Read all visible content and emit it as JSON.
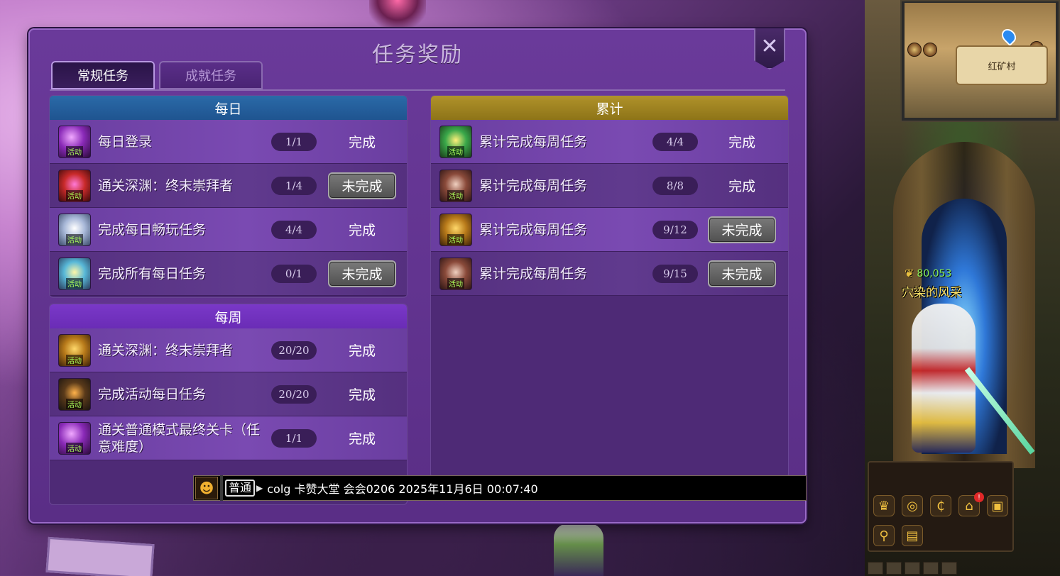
{
  "dialog": {
    "title": "任务奖励",
    "close_label": "✕",
    "tabs": [
      {
        "label": "常规任务",
        "active": true
      },
      {
        "label": "成就任务",
        "active": false
      }
    ]
  },
  "daily": {
    "title": "每日",
    "tasks": [
      {
        "icon": "daily-login-icon",
        "name": "每日登录",
        "progress": "1/1",
        "status": "完成",
        "done": true
      },
      {
        "icon": "abyss-icon",
        "name": "通关深渊：终末崇拜者",
        "progress": "1/4",
        "status": "未完成",
        "done": false
      },
      {
        "icon": "daily-play-icon",
        "name": "完成每日畅玩任务",
        "progress": "4/4",
        "status": "完成",
        "done": true
      },
      {
        "icon": "all-daily-icon",
        "name": "完成所有每日任务",
        "progress": "0/1",
        "status": "未完成",
        "done": false
      }
    ]
  },
  "weekly": {
    "title": "每周",
    "tasks": [
      {
        "icon": "abyss-weekly-icon",
        "name": "通关深渊：终末崇拜者",
        "progress": "20/20",
        "status": "完成",
        "done": true
      },
      {
        "icon": "potion-icon",
        "name": "完成活动每日任务",
        "progress": "20/20",
        "status": "完成",
        "done": true
      },
      {
        "icon": "normal-stage-icon",
        "name": "通关普通模式最终关卡（任意难度）",
        "progress": "1/1",
        "status": "完成",
        "done": true
      }
    ]
  },
  "total": {
    "title": "累计",
    "tasks": [
      {
        "icon": "weekly-total-icon",
        "name": "累计完成每周任务",
        "progress": "4/4",
        "status": "完成",
        "done": true
      },
      {
        "icon": "weekly-total-icon-2",
        "name": "累计完成每周任务",
        "progress": "8/8",
        "status": "完成",
        "done": true
      },
      {
        "icon": "weekly-total-icon-3",
        "name": "累计完成每周任务",
        "progress": "9/12",
        "status": "未完成",
        "done": false
      },
      {
        "icon": "weekly-total-icon-4",
        "name": "累计完成每周任务",
        "progress": "9/15",
        "status": "未完成",
        "done": false
      }
    ]
  },
  "badge_text": "活动",
  "chat": {
    "channel": "普通",
    "message": "colg 卡赞大堂 会会0206 2025年11月6日 00:07:40"
  },
  "scene": {
    "minimap_label": "红矿村",
    "player_score": "80,053",
    "player_name": "穴染的风采",
    "notification_count": "!"
  }
}
